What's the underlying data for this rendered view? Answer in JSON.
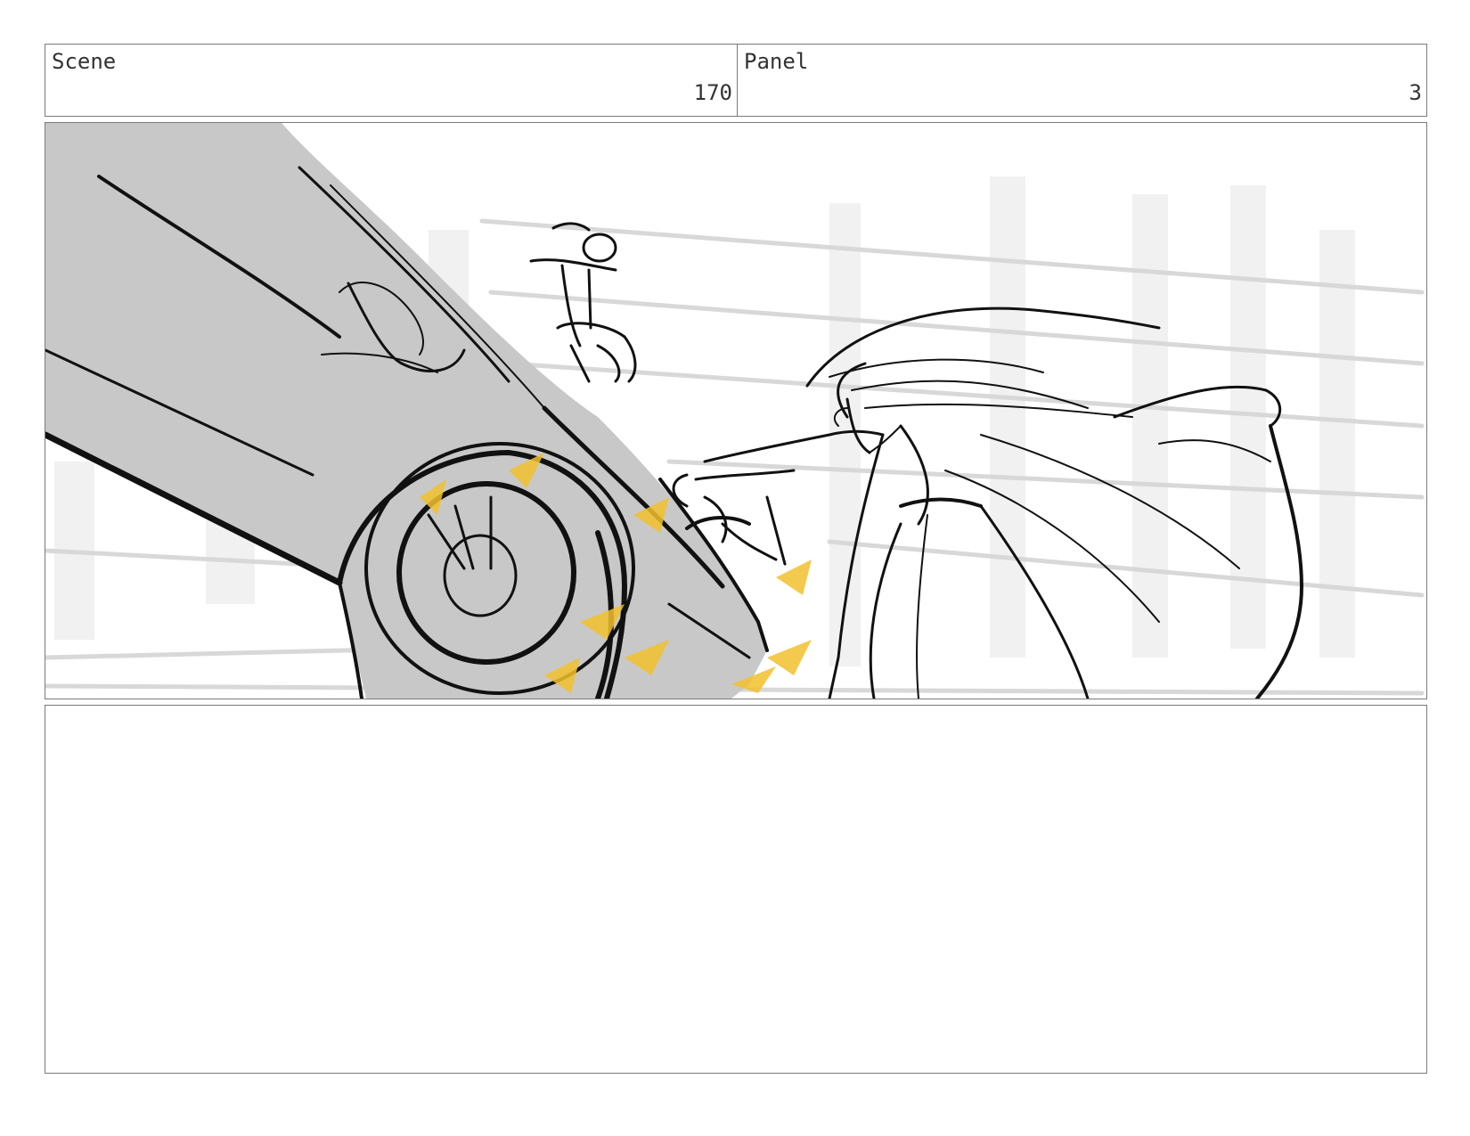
{
  "header": {
    "scene": {
      "label": "Scene",
      "value": "170"
    },
    "panel": {
      "label": "Panel",
      "value": "3"
    }
  },
  "frame": {
    "subject": "car-and-figure-collision-sketch",
    "colors": {
      "car_fill": "#c8c8c8",
      "ink": "#111111",
      "sparks": "#f2c12e",
      "speed_lines": "#d6d6d6"
    }
  },
  "notes": {
    "text": ""
  }
}
